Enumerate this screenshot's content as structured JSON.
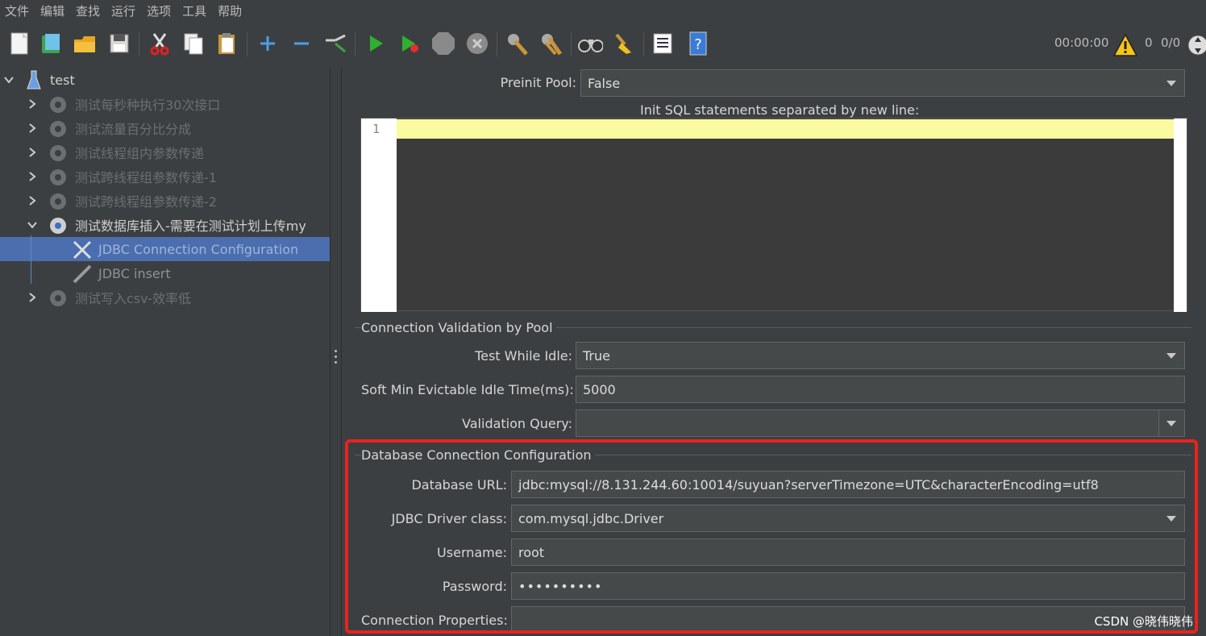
{
  "menu": [
    "文件",
    "编辑",
    "查找",
    "运行",
    "选项",
    "工具",
    "帮助"
  ],
  "toolbar": {
    "timer": "00:00:00",
    "warning_count": "0",
    "thread_count": "0/0"
  },
  "tree": {
    "root": "test",
    "items": [
      {
        "label": "测试每秒种执行30次接口"
      },
      {
        "label": "测试流量百分比分成"
      },
      {
        "label": "测试线程组内参数传递"
      },
      {
        "label": "测试跨线程组参数传递-1"
      },
      {
        "label": "测试跨线程组参数传递-2"
      },
      {
        "label": "测试数据库插入-需要在测试计划上传my"
      },
      {
        "label": "JDBC Connection Configuration"
      },
      {
        "label": "JDBC insert"
      },
      {
        "label": "测试写入csv-效率低"
      }
    ]
  },
  "form": {
    "preinit_pool_label": "Preinit Pool:",
    "preinit_pool_value": "False",
    "init_sql_label": "Init SQL statements separated by new line:",
    "editor_line": "1",
    "validation_section": "Connection Validation by Pool",
    "test_while_idle_label": "Test While Idle:",
    "test_while_idle_value": "True",
    "soft_min_label": "Soft Min Evictable Idle Time(ms):",
    "soft_min_value": "5000",
    "validation_query_label": "Validation Query:",
    "validation_query_value": "",
    "db_section": "Database Connection Configuration",
    "db_url_label": "Database URL:",
    "db_url_value": "jdbc:mysql://8.131.244.60:10014/suyuan?serverTimezone=UTC&characterEncoding=utf8",
    "driver_label": "JDBC Driver class:",
    "driver_value": "com.mysql.jdbc.Driver",
    "username_label": "Username:",
    "username_value": "root",
    "password_label": "Password:",
    "password_value": "••••••••••",
    "conn_props_label": "Connection Properties:",
    "conn_props_value": ""
  },
  "watermark": "CSDN @晓伟晓伟",
  "colors": {
    "background": "#3c3f41",
    "selection": "#4b6eaf",
    "highlight_box": "#e8231e",
    "current_line": "#fafaa0"
  }
}
